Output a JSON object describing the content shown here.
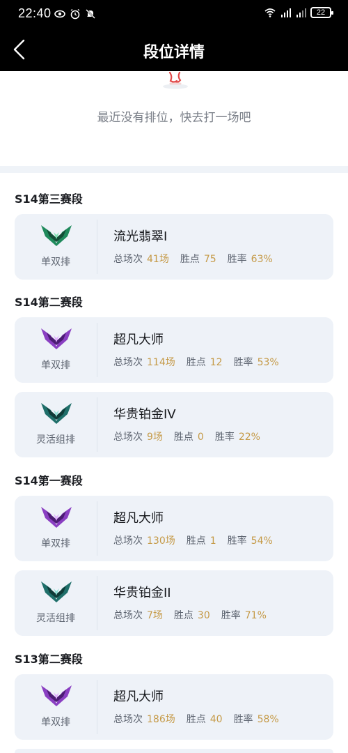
{
  "status_bar": {
    "time": "22:40",
    "battery": "22"
  },
  "header": {
    "title": "段位详情"
  },
  "notice": {
    "message": "最近没有排位，快去打一场吧"
  },
  "stats_labels": {
    "games": "总场次",
    "points": "胜点",
    "winrate": "胜率"
  },
  "seasons": [
    {
      "title": "S14第三赛段",
      "cards": [
        {
          "rank": "流光翡翠I",
          "queue": "单双排",
          "emblem": "emerald-emblem-icon",
          "games": "41场",
          "points": "75",
          "winrate": "63%"
        }
      ]
    },
    {
      "title": "S14第二赛段",
      "cards": [
        {
          "rank": "超凡大师",
          "queue": "单双排",
          "emblem": "master-emblem-icon",
          "games": "114场",
          "points": "12",
          "winrate": "53%"
        },
        {
          "rank": "华贵铂金IV",
          "queue": "灵活组排",
          "emblem": "platinum-emblem-icon",
          "games": "9场",
          "points": "0",
          "winrate": "22%"
        }
      ]
    },
    {
      "title": "S14第一赛段",
      "cards": [
        {
          "rank": "超凡大师",
          "queue": "单双排",
          "emblem": "master-emblem-icon",
          "games": "130场",
          "points": "1",
          "winrate": "54%"
        },
        {
          "rank": "华贵铂金II",
          "queue": "灵活组排",
          "emblem": "platinum-emblem-icon",
          "games": "7场",
          "points": "30",
          "winrate": "71%"
        }
      ]
    },
    {
      "title": "S13第二赛段",
      "cards": [
        {
          "rank": "超凡大师",
          "queue": "单双排",
          "emblem": "master-emblem-icon",
          "games": "186场",
          "points": "40",
          "winrate": "58%"
        }
      ]
    }
  ],
  "colors": {
    "card_bg": "#eef2f8",
    "value_gold": "#c59a47",
    "emerald": "#1f8a5c",
    "master": "#8a3fc2",
    "platinum": "#1f6f6a"
  }
}
